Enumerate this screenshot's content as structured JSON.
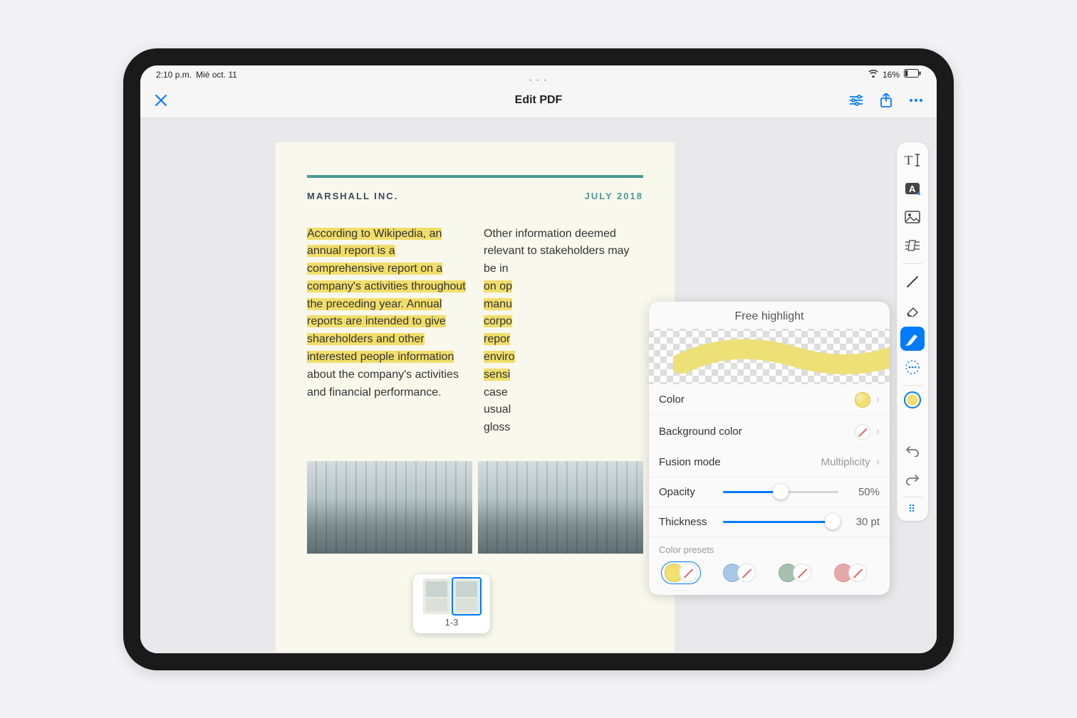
{
  "status": {
    "time": "2:10 p.m.",
    "date": "Mié oct. 11",
    "battery": "16%"
  },
  "nav": {
    "title": "Edit PDF"
  },
  "document": {
    "company": "MARSHALL INC.",
    "date": "JULY 2018",
    "col1_highlighted": "According to Wikipedia, an annual report is a comprehensive report on a company's activities throughout the preceding year. Annual reports are intended to give shareholders and other interested people information",
    "col1_tail": " about the company's activities and financial performance.",
    "col2_a": "Other information deemed relevant to stakeholders may be in",
    "col2_b": "on op",
    "col2_c": "manu",
    "col2_d": "corpo",
    "col2_e": "repor",
    "col2_f": "enviro",
    "col2_g": "sensi",
    "col2_h": "case ",
    "col2_i": "usual",
    "col2_j": "gloss"
  },
  "thumbs": {
    "label": "1-3"
  },
  "popover": {
    "title": "Free highlight",
    "rows": {
      "color": "Color",
      "bg": "Background color",
      "fusion": "Fusion mode",
      "fusion_value": "Multiplicity",
      "opacity": "Opacity",
      "opacity_value": "50%",
      "thickness": "Thickness",
      "thickness_value": "30 pt",
      "presets": "Color presets"
    },
    "opacity_pct": 50,
    "thickness_pct": 95,
    "preset_colors": [
      "#f3df6f",
      "#a7c7e7",
      "#a6c0b0",
      "#e6a9a9"
    ]
  },
  "preview_stroke_color": "#ece077"
}
